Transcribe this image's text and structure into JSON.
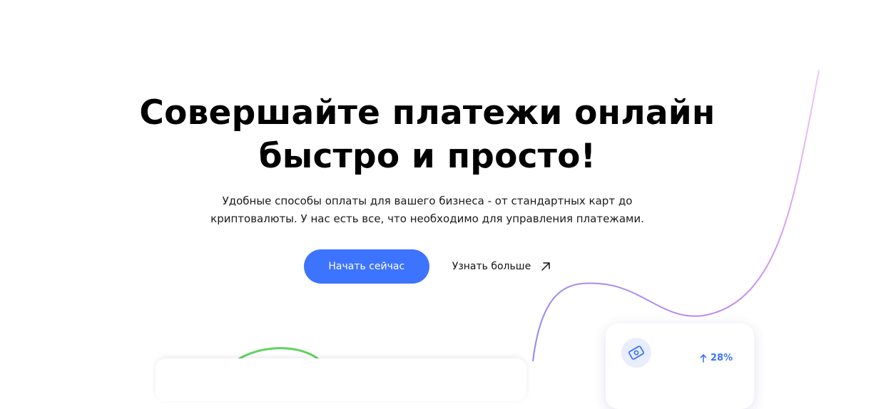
{
  "hero": {
    "title_line1": "Совершайте платежи онлайн",
    "title_line2": "быстро и просто!",
    "subtitle_line1": "Удобные способы оплаты для вашего бизнеса - от стандартных карт до",
    "subtitle_line2": "криптовалюты. У нас есть все, что необходимо для управления платежами."
  },
  "actions": {
    "start_label": "Начать сейчас",
    "learn_more_label": "Узнать больше",
    "learn_more_icon": "arrow-up-right-icon"
  },
  "stat_card": {
    "icon": "payment-card-icon",
    "growth_icon": "arrow-up-icon",
    "growth_value": "28%"
  },
  "colors": {
    "accent": "#3c73ff",
    "green_curve": "#5fd35f",
    "curve_purple": "#9b7bf5",
    "curve_pink": "#e6a2f0"
  }
}
